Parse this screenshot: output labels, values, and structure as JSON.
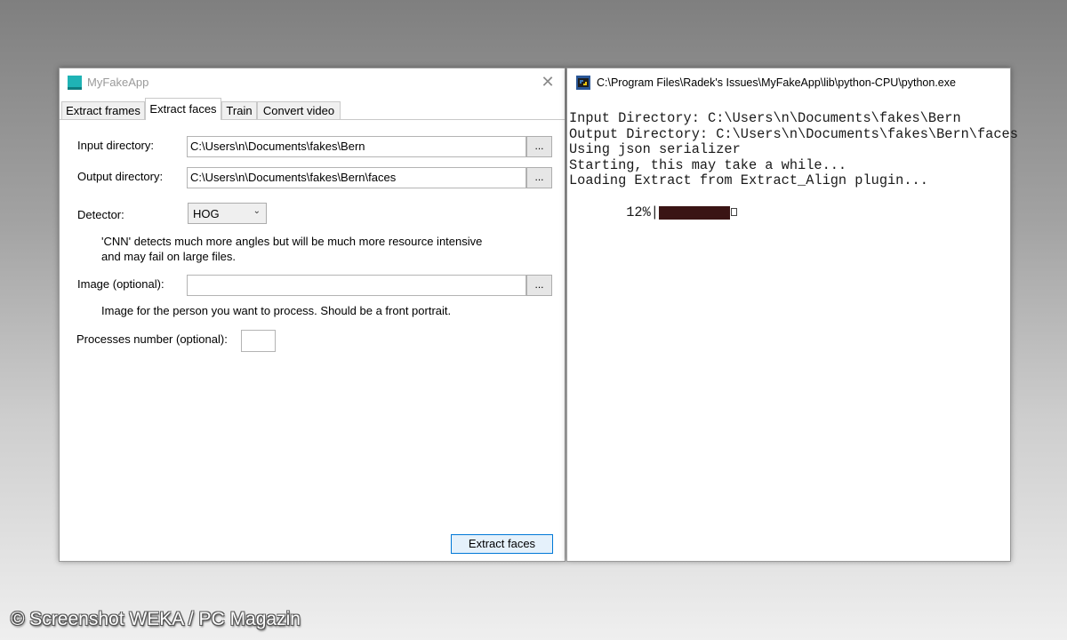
{
  "app": {
    "title": "MyFakeApp",
    "close_glyph": "✕",
    "tabs": [
      {
        "label": "Extract frames",
        "active": false
      },
      {
        "label": "Extract faces",
        "active": true
      },
      {
        "label": "Train",
        "active": false
      },
      {
        "label": "Convert video",
        "active": false
      }
    ],
    "form": {
      "input_dir_label": "Input directory:",
      "input_dir_value": "C:\\Users\\n\\Documents\\fakes\\Bern",
      "output_dir_label": "Output directory:",
      "output_dir_value": "C:\\Users\\n\\Documents\\fakes\\Bern\\faces",
      "browse_label": "...",
      "detector_label": "Detector:",
      "detector_value": "HOG",
      "detector_hint_1": "'CNN' detects much more angles but will be much more resource intensive",
      "detector_hint_2": "and may fail on large files.",
      "image_label": "Image (optional):",
      "image_value": "",
      "image_hint": "Image for the person you want to process. Should be a front portrait.",
      "processes_label": "Processes number (optional):",
      "processes_value": "",
      "submit_label": "Extract faces"
    },
    "accent_color": "#0078d7",
    "icon_color": "#1fb3b5"
  },
  "console": {
    "title": "C:\\Program Files\\Radek's Issues\\MyFakeApp\\lib\\python-CPU\\python.exe",
    "icon": "python-icon",
    "lines": [
      "Input Directory: C:\\Users\\n\\Documents\\fakes\\Bern",
      "Output Directory: C:\\Users\\n\\Documents\\fakes\\Bern\\faces",
      "Using json serializer",
      "Starting, this may take a while...",
      "Loading Extract from Extract_Align plugin..."
    ],
    "progress_label": " 12%",
    "progress_separator": "|",
    "progress_fraction": 1.0,
    "progress_color": "#3a1414"
  },
  "watermark": "© Screenshot WEKA / PC Magazin"
}
